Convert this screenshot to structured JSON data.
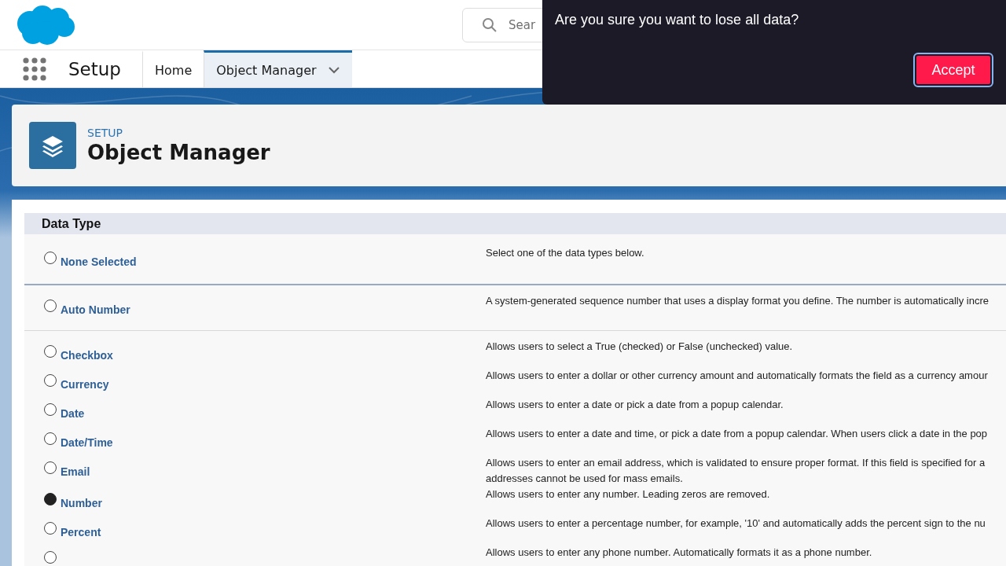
{
  "header": {
    "search": {
      "placeholder": "Sear"
    }
  },
  "nav": {
    "app_name": "Setup",
    "tabs": [
      {
        "label": "Home",
        "selected": false,
        "menu": false
      },
      {
        "label": "Object Manager",
        "selected": true,
        "menu": true
      }
    ]
  },
  "page_header": {
    "eyebrow": "SETUP",
    "title": "Object Manager"
  },
  "section": {
    "title": "Data Type",
    "groups": [
      {
        "items": [
          {
            "label": "None Selected",
            "selected": false,
            "description": [
              "Select one of the data types below."
            ]
          }
        ]
      },
      {
        "items": [
          {
            "label": "Auto Number",
            "selected": false,
            "description": [
              "A system-generated sequence number that uses a display format you define. The number is automatically incre"
            ]
          }
        ]
      },
      {
        "items": [
          {
            "label": "Checkbox",
            "selected": false,
            "description": [
              "Allows users to select a True (checked) or False (unchecked) value."
            ]
          },
          {
            "label": "Currency",
            "selected": false,
            "description": [
              "Allows users to enter a dollar or other currency amount and automatically formats the field as a currency amour"
            ]
          },
          {
            "label": "Date",
            "selected": false,
            "description": [
              "Allows users to enter a date or pick a date from a popup calendar."
            ]
          },
          {
            "label": "Date/Time",
            "selected": false,
            "description": [
              "Allows users to enter a date and time, or pick a date from a popup calendar. When users click a date in the pop"
            ]
          },
          {
            "label": "Email",
            "selected": false,
            "description": [
              "Allows users to enter an email address, which is validated to ensure proper format. If this field is specified for a",
              "addresses cannot be used for mass emails."
            ]
          },
          {
            "label": "Number",
            "selected": true,
            "description": [
              "Allows users to enter any number. Leading zeros are removed."
            ]
          },
          {
            "label": "Percent",
            "selected": false,
            "description": [
              "Allows users to enter a percentage number, for example, '10' and automatically adds the percent sign to the nu"
            ]
          },
          {
            "selected": false,
            "description": [
              "Allows users to enter any phone number. Automatically formats it as a phone number."
            ]
          }
        ]
      }
    ]
  },
  "dialog": {
    "message": "Are you sure you want to lose all data?",
    "button": "Accept"
  }
}
